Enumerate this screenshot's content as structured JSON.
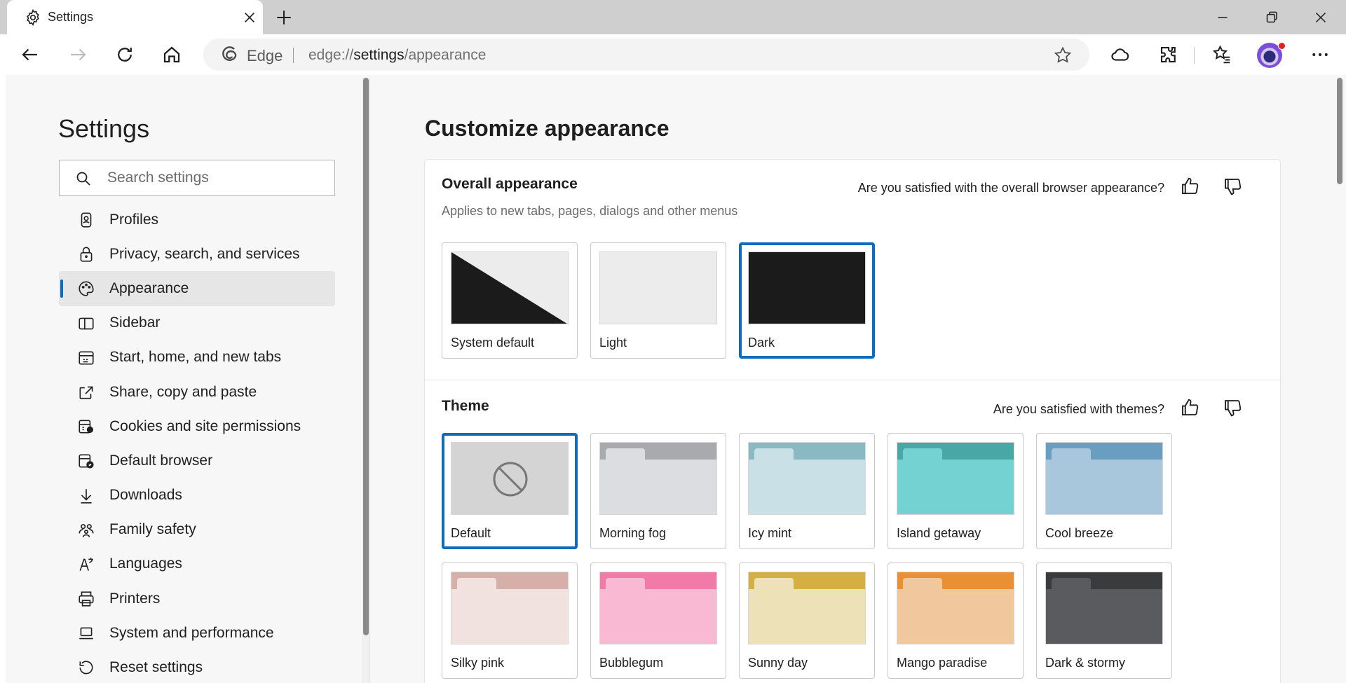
{
  "window": {
    "tab_title": "Settings"
  },
  "toolbar": {
    "address_label": "Edge",
    "url_prefix": "edge://",
    "url_bold": "settings",
    "url_suffix": "/appearance"
  },
  "sidebar": {
    "title": "Settings",
    "search_placeholder": "Search settings",
    "items": [
      {
        "label": "Profiles",
        "icon": "profiles-icon"
      },
      {
        "label": "Privacy, search, and services",
        "icon": "lock-icon"
      },
      {
        "label": "Appearance",
        "icon": "palette-icon",
        "active": true
      },
      {
        "label": "Sidebar",
        "icon": "sidebar-icon"
      },
      {
        "label": "Start, home, and new tabs",
        "icon": "home-tabs-icon"
      },
      {
        "label": "Share, copy and paste",
        "icon": "share-icon"
      },
      {
        "label": "Cookies and site permissions",
        "icon": "cookies-icon"
      },
      {
        "label": "Default browser",
        "icon": "default-browser-icon"
      },
      {
        "label": "Downloads",
        "icon": "download-icon"
      },
      {
        "label": "Family safety",
        "icon": "family-icon"
      },
      {
        "label": "Languages",
        "icon": "languages-icon"
      },
      {
        "label": "Printers",
        "icon": "printer-icon"
      },
      {
        "label": "System and performance",
        "icon": "laptop-icon"
      },
      {
        "label": "Reset settings",
        "icon": "reset-icon"
      }
    ]
  },
  "main": {
    "title": "Customize appearance",
    "overall": {
      "title": "Overall appearance",
      "subtitle": "Applies to new tabs, pages, dialogs and other menus",
      "question": "Are you satisfied with the overall browser appearance?",
      "options": [
        {
          "label": "System default",
          "selected": false
        },
        {
          "label": "Light",
          "selected": false
        },
        {
          "label": "Dark",
          "selected": true
        }
      ]
    },
    "theme": {
      "title": "Theme",
      "question": "Are you satisfied with themes?",
      "options": [
        {
          "label": "Default",
          "selected": true,
          "tab": "#d4d4d4",
          "body": "#d4d4d4"
        },
        {
          "label": "Morning fog",
          "tab": "#a9aaad",
          "body": "#dcdde1"
        },
        {
          "label": "Icy mint",
          "tab": "#89b9c3",
          "body": "#c9e1e6"
        },
        {
          "label": "Island getaway",
          "tab": "#49a8a6",
          "body": "#74d2d3"
        },
        {
          "label": "Cool breeze",
          "tab": "#6a9ec1",
          "body": "#a8c6dc"
        },
        {
          "label": "Silky pink",
          "tab": "#d6afa9",
          "body": "#f1e1df"
        },
        {
          "label": "Bubblegum",
          "tab": "#f27aa8",
          "body": "#f9b9d3"
        },
        {
          "label": "Sunny day",
          "tab": "#d6af43",
          "body": "#ede1b7"
        },
        {
          "label": "Mango paradise",
          "tab": "#e89033",
          "body": "#f1c89e"
        },
        {
          "label": "Dark & stormy",
          "tab": "#3a3b3d",
          "body": "#5a5b5f"
        }
      ]
    }
  },
  "colors": {
    "accent": "#0f6cbd"
  }
}
